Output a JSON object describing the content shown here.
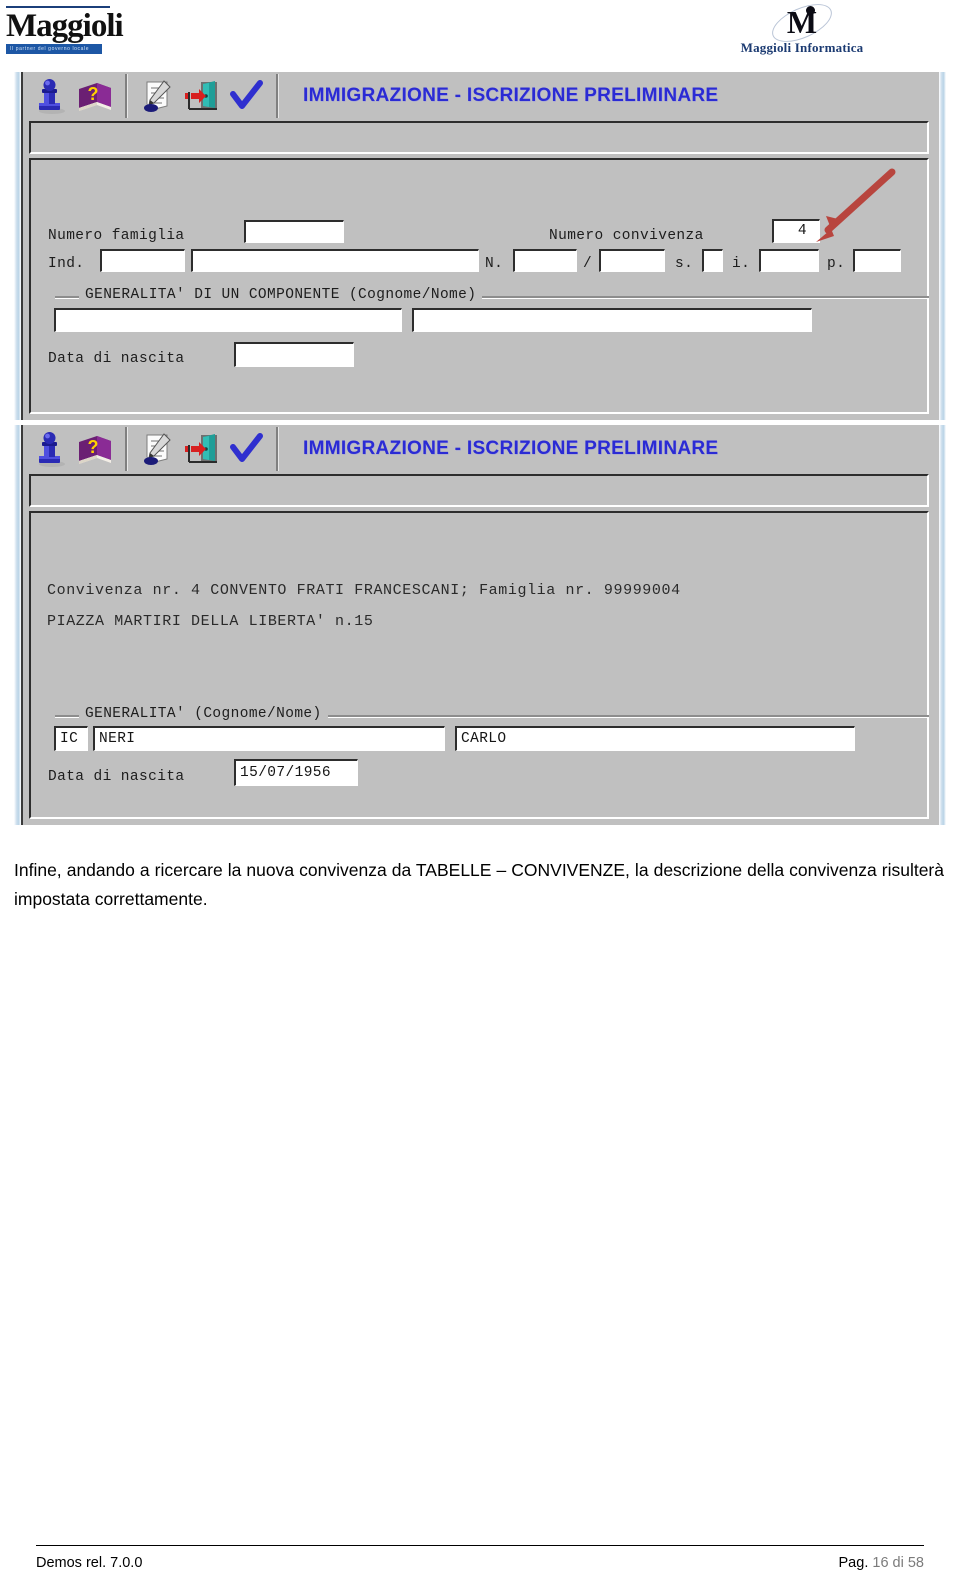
{
  "header": {
    "maggioli_logo": {
      "wordmark": "Maggioli",
      "tagline": "Il partner del governo locale",
      "icon": "maggioli-logo"
    },
    "informatica_logo": {
      "monogram": "M",
      "name": "Maggioli Informatica",
      "icon": "maggioli-informatica-logo"
    }
  },
  "window_top": {
    "title": "IMMIGRAZIONE - ISCRIZIONE PRELIMINARE",
    "toolbar": [
      {
        "name": "user-icon",
        "label": "Utente"
      },
      {
        "name": "help-book-icon",
        "label": "Guida"
      },
      {
        "name": "document-edit-icon",
        "label": "Stampa"
      },
      {
        "name": "exit-door-icon",
        "label": "Esci"
      },
      {
        "name": "confirm-check-icon",
        "label": "Conferma"
      }
    ],
    "fields": {
      "numero_famiglia_label": "Numero famiglia",
      "numero_famiglia_value": "",
      "numero_convivenza_label": "Numero convivenza",
      "numero_convivenza_value": "4",
      "ind_label": "Ind.",
      "ind_code_value": "",
      "ind_street_value": "",
      "n_label": "N.",
      "n_value": "",
      "slash_label": "/",
      "n_suffix_value": "",
      "s_label": "s.",
      "s_value": "",
      "i_label": "i.",
      "i_value": "",
      "p_label": "p.",
      "p_value": "",
      "generalita_legend": "GENERALITA' DI UN COMPONENTE  (Cognome/Nome)",
      "cognome_value": "",
      "nome_value": "",
      "data_nascita_label": "Data di nascita",
      "data_nascita_value": ""
    }
  },
  "window_bottom": {
    "title": "IMMIGRAZIONE - ISCRIZIONE PRELIMINARE",
    "toolbar": [
      {
        "name": "user-icon",
        "label": "Utente"
      },
      {
        "name": "help-book-icon",
        "label": "Guida"
      },
      {
        "name": "document-edit-icon",
        "label": "Stampa"
      },
      {
        "name": "exit-door-icon",
        "label": "Esci"
      },
      {
        "name": "confirm-check-icon",
        "label": "Conferma"
      }
    ],
    "status_line_1": "Convivenza nr. 4 CONVENTO FRATI FRANCESCANI; Famiglia nr. 99999004",
    "status_line_2": "PIAZZA MARTIRI DELLA LIBERTA' n.15",
    "fields": {
      "generalita_legend": "GENERALITA'  (Cognome/Nome)",
      "ic_value": "IC",
      "cognome_value": "NERI",
      "nome_value": "CARLO",
      "data_nascita_label": "Data di nascita",
      "data_nascita_value": "15/07/1956"
    }
  },
  "annotation": {
    "arrow_color": "#b8453e",
    "points_to": "numero-convivenza-field"
  },
  "body": {
    "paragraph": "Infine, andando a ricercare la nuova convivenza da TABELLE – CONVIVENZE, la descrizione della convivenza risulterà impostata correttamente."
  },
  "footer": {
    "left": "Demos rel. 7.0.0",
    "right_label": "Pag.",
    "right_value": "16 di 58"
  },
  "colors": {
    "window_face": "#c0c0c0",
    "title_blue": "#2b2bd4",
    "accent_red": "#b8453e",
    "logo_blue": "#1d57a5"
  }
}
